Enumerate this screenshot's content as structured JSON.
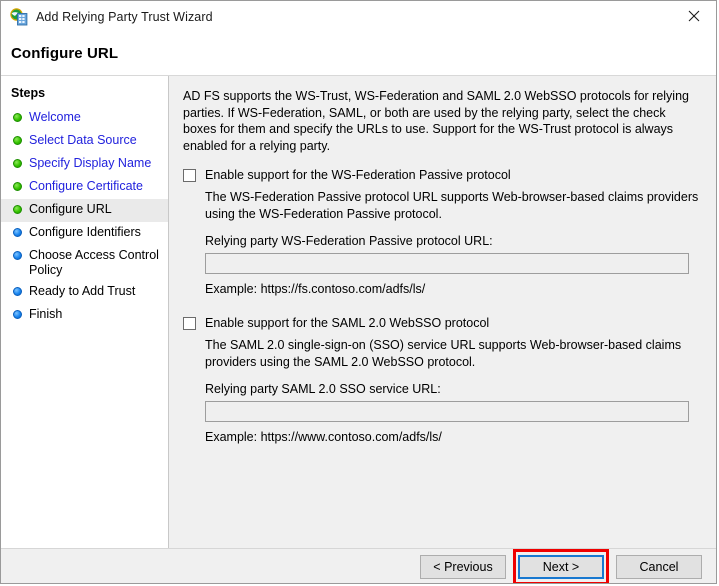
{
  "window": {
    "title": "Add Relying Party Trust Wizard",
    "icon": "adfs-globe-server-icon",
    "close_label": "✕"
  },
  "header": {
    "title": "Configure URL"
  },
  "sidebar": {
    "title": "Steps",
    "items": [
      {
        "label": "Welcome",
        "state": "done"
      },
      {
        "label": "Select Data Source",
        "state": "done"
      },
      {
        "label": "Specify Display Name",
        "state": "done"
      },
      {
        "label": "Configure Certificate",
        "state": "done"
      },
      {
        "label": "Configure URL",
        "state": "current"
      },
      {
        "label": "Configure Identifiers",
        "state": "todo"
      },
      {
        "label": "Choose Access Control Policy",
        "state": "todo"
      },
      {
        "label": "Ready to Add Trust",
        "state": "todo"
      },
      {
        "label": "Finish",
        "state": "todo"
      }
    ]
  },
  "main": {
    "intro": "AD FS supports the WS-Trust, WS-Federation and SAML 2.0 WebSSO protocols for relying parties.  If WS-Federation, SAML, or both are used by the relying party, select the check boxes for them and specify the URLs to use.  Support for the WS-Trust protocol is always enabled for a relying party.",
    "wsfed": {
      "checkbox_label": "Enable support for the WS-Federation Passive protocol",
      "checked": false,
      "description": "The WS-Federation Passive protocol URL supports Web-browser-based claims providers using the WS-Federation Passive protocol.",
      "field_label": "Relying party WS-Federation Passive protocol URL:",
      "value": "",
      "placeholder": "",
      "example": "Example: https://fs.contoso.com/adfs/ls/"
    },
    "saml": {
      "checkbox_label": "Enable support for the SAML 2.0 WebSSO protocol",
      "checked": false,
      "description": "The SAML 2.0 single-sign-on (SSO) service URL supports Web-browser-based claims providers using the SAML 2.0 WebSSO protocol.",
      "field_label": "Relying party SAML 2.0 SSO service URL:",
      "value": "",
      "placeholder": "",
      "example": "Example: https://www.contoso.com/adfs/ls/"
    }
  },
  "footer": {
    "previous_label": "< Previous",
    "next_label": "Next >",
    "cancel_label": "Cancel",
    "focused_button": "Next >"
  },
  "colors": {
    "step_link": "#2222dd",
    "bullet_done": "#36c400",
    "bullet_todo": "#1a86f0",
    "focus_border": "#1878d0",
    "annotation": "#ef0000",
    "content_bg": "#f0f0f0"
  }
}
